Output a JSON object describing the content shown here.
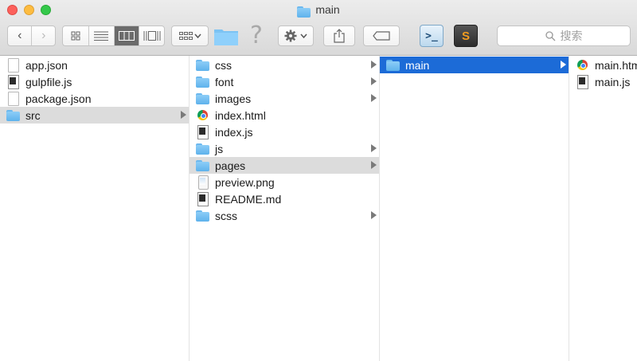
{
  "window": {
    "title": "main"
  },
  "toolbar": {
    "back_glyph": "‹",
    "forward_glyph": "›",
    "help_glyph": "?",
    "vscode_glyph": ">_",
    "sublime_glyph": "S",
    "search_placeholder": "搜索",
    "search_glyph": "⌕"
  },
  "colors": {
    "selection_active": "#1c6bd7",
    "selection_inactive": "#dcdcdc",
    "folder": "#6cb8ee"
  },
  "columns": [
    {
      "items": [
        {
          "name": "app.json",
          "icon": "document-icon"
        },
        {
          "name": "gulpfile.js",
          "icon": "script-icon"
        },
        {
          "name": "package.json",
          "icon": "document-icon"
        },
        {
          "name": "src",
          "icon": "folder-icon",
          "selected": "inactive",
          "has_children": true
        }
      ]
    },
    {
      "items": [
        {
          "name": "css",
          "icon": "folder-icon",
          "has_children": true
        },
        {
          "name": "font",
          "icon": "folder-icon",
          "has_children": true
        },
        {
          "name": "images",
          "icon": "folder-icon",
          "has_children": true
        },
        {
          "name": "index.html",
          "icon": "chrome-html-icon"
        },
        {
          "name": "index.js",
          "icon": "script-icon"
        },
        {
          "name": "js",
          "icon": "folder-icon",
          "has_children": true
        },
        {
          "name": "pages",
          "icon": "folder-icon",
          "selected": "inactive",
          "has_children": true
        },
        {
          "name": "preview.png",
          "icon": "image-icon"
        },
        {
          "name": "README.md",
          "icon": "script-icon"
        },
        {
          "name": "scss",
          "icon": "folder-icon",
          "has_children": true
        }
      ]
    },
    {
      "items": [
        {
          "name": "main",
          "icon": "folder-icon",
          "selected": "active",
          "has_children": true
        }
      ]
    },
    {
      "items": [
        {
          "name": "main.html",
          "icon": "chrome-html-icon"
        },
        {
          "name": "main.js",
          "icon": "script-icon"
        }
      ]
    }
  ]
}
